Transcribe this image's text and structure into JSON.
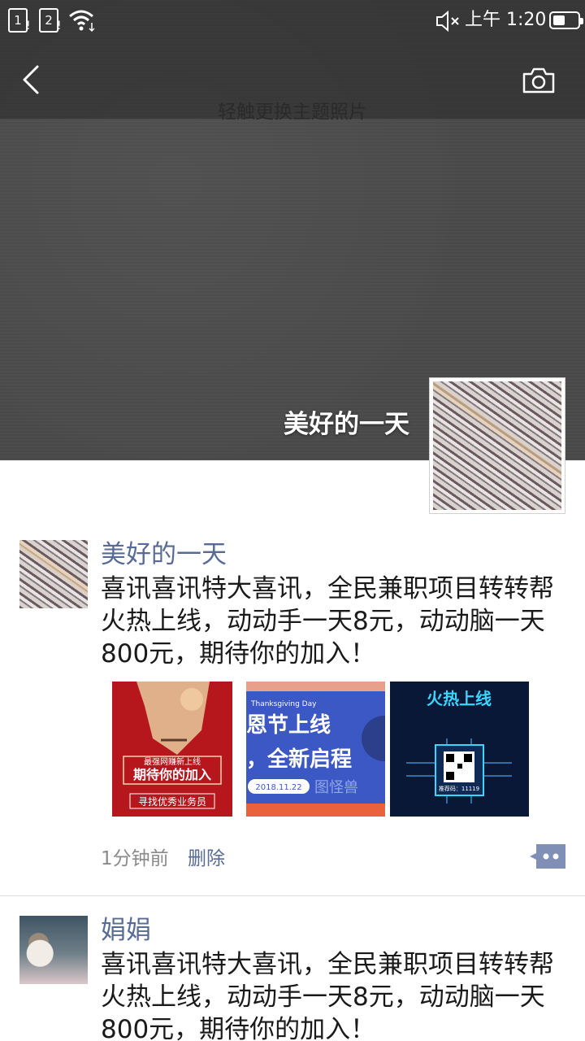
{
  "status_bar": {
    "sim1": "1",
    "sim2": "2",
    "time": "上午 1:20",
    "icons": [
      "sim-icon",
      "wifi-icon",
      "mute-icon",
      "battery-icon"
    ]
  },
  "header": {
    "hint": "轻触更换主题照片",
    "cover_name": "美好的一天",
    "icons": [
      "back-arrow-icon",
      "camera-icon"
    ]
  },
  "feed": [
    {
      "author": "美好的一天",
      "text": "喜讯喜讯特大喜讯，全民兼职项目转转帮火热上线，动动手一天8元，动动脑一天800元，期待你的加入！",
      "images": [
        {
          "lines": [
            "最强网赚新上线",
            "期待你的加入",
            "寻找优秀业务员"
          ]
        },
        {
          "lines": [
            "Thanksgiving Day",
            "恩节上线",
            "，全新启程",
            "2018.11.22",
            "图怪兽"
          ]
        },
        {
          "lines": [
            "火热上线",
            "推荐码：11119"
          ]
        }
      ],
      "time": "1分钟前",
      "delete_label": "删除"
    },
    {
      "author": "娟娟",
      "text": "喜讯喜讯特大喜讯，全民兼职项目转转帮火热上线，动动手一天8元，动动脑一天800元，期待你的加入！"
    }
  ],
  "colors": {
    "link": "#576b95",
    "cover": "#4a4a4a",
    "meta": "#8a8a8a"
  }
}
